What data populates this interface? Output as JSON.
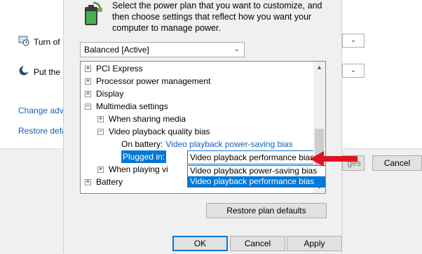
{
  "background": {
    "row1": {
      "label": "Turn of",
      "icon": "monitor-clock-icon",
      "dropdown_chevron": "⌄"
    },
    "row2": {
      "label": "Put the",
      "icon": "moon-icon",
      "dropdown_chevron": "⌄"
    },
    "links": [
      "Change adv",
      "Restore defa"
    ],
    "buttons": {
      "partial": "ges",
      "cancel": "Cancel"
    }
  },
  "dialog": {
    "intro_text": "Select the power plan that you want to customize, and then choose settings that reflect how you want your computer to manage power.",
    "plan_select": {
      "value": "Balanced [Active]"
    },
    "tree": [
      {
        "label": "PCI Express",
        "expander": "+"
      },
      {
        "label": "Processor power management",
        "expander": "+"
      },
      {
        "label": "Display",
        "expander": "+"
      },
      {
        "label": "Multimedia settings",
        "expander": "−"
      },
      {
        "label": "When sharing media",
        "expander": "+"
      },
      {
        "label": "Video playback quality bias",
        "expander": "−"
      },
      {
        "label": "When playing vi",
        "expander": "+"
      },
      {
        "label": "Battery",
        "expander": "+"
      }
    ],
    "on_battery": {
      "label": "On battery:",
      "value": "Video playback power-saving bias"
    },
    "plugged_in": {
      "label": "Plugged in:",
      "value": "Video playback performance bias"
    },
    "options": [
      "Video playback power-saving bias",
      "Video playback performance bias"
    ],
    "restore_button": "Restore plan defaults",
    "ok": "OK",
    "cancel": "Cancel",
    "apply": "Apply"
  },
  "colors": {
    "accent": "#0078d7",
    "link": "#1a5fb4",
    "annotation_arrow": "#e0141e"
  }
}
